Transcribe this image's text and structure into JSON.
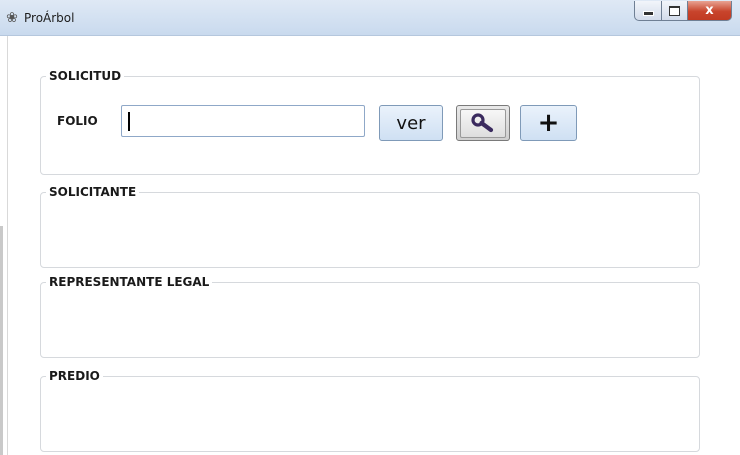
{
  "window": {
    "title": "ProÁrbol",
    "icon": "tree-emblem-icon",
    "controls": {
      "minimize": "minimize-icon",
      "maximize": "maximize-icon",
      "close_label": "x"
    }
  },
  "groups": {
    "solicitud": {
      "title": "SOLICITUD",
      "folio_label": "FOLIO",
      "folio_value": "",
      "ver_label": "ver",
      "search_icon": "magnifier-icon",
      "add_label": "+"
    },
    "solicitante": {
      "title": "SOLICITANTE"
    },
    "representante": {
      "title": "REPRESENTANTE LEGAL"
    },
    "predio": {
      "title": "PREDIO"
    }
  }
}
